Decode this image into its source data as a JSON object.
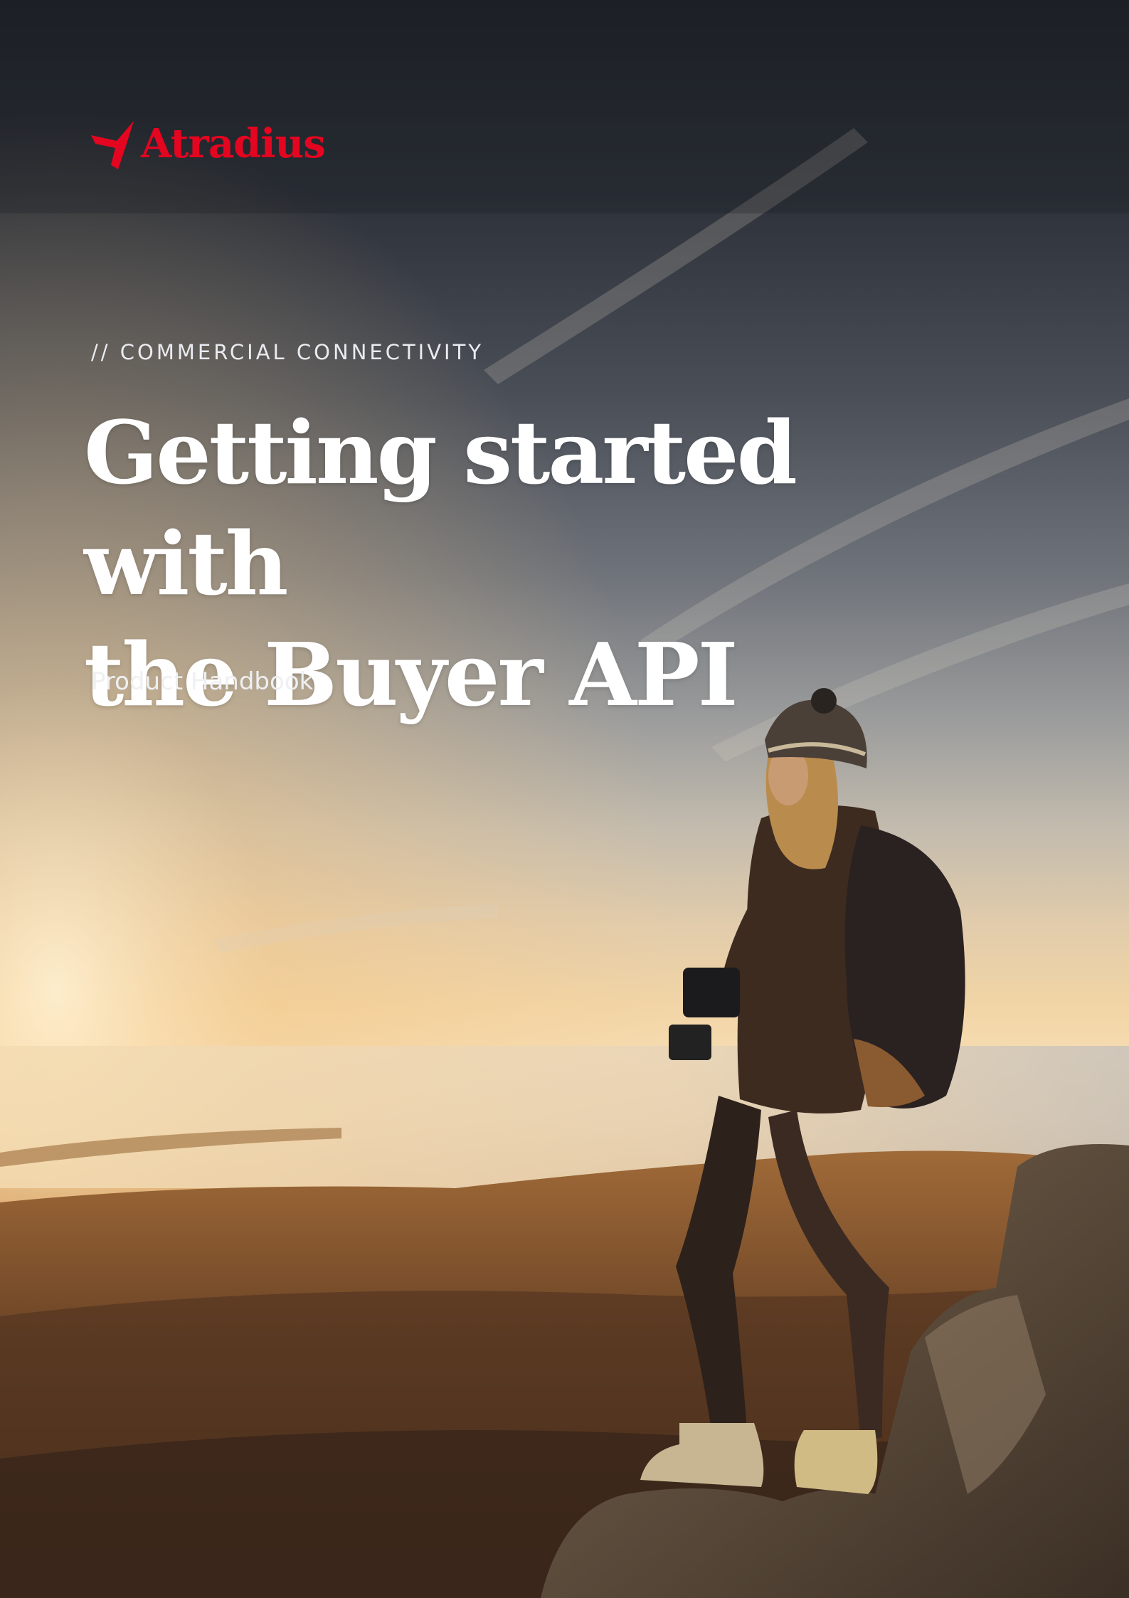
{
  "brand": {
    "name": "Atradius",
    "color": "#e40520",
    "logo_icon": "atradius-bird-icon"
  },
  "cover": {
    "eyebrow": "// COMMERCIAL CONNECTIVITY",
    "title_line1": "Getting started with",
    "title_line2": "the Buyer API",
    "subtitle": "Product Handbook"
  },
  "photo": {
    "subject": "hiker-on-mountain-at-sunrise"
  }
}
